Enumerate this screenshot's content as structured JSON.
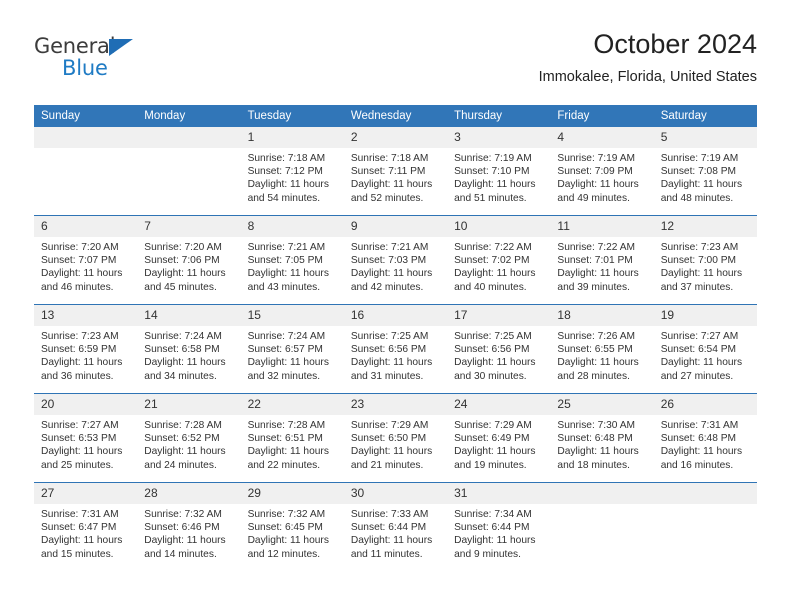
{
  "logo": {
    "word_one": "General",
    "word_two": "Blue",
    "triangle_icon": "triangle-icon",
    "brand_blue": "#1f7bc4",
    "brand_dark": "#3c3c3c"
  },
  "header": {
    "title": "October 2024",
    "subtitle": "Immokalee, Florida, United States"
  },
  "calendar": {
    "header_bg": "#3176b8",
    "daynum_bg": "#f0f0f0",
    "row_divider": "#2f74b5",
    "weekday_headers": [
      "Sunday",
      "Monday",
      "Tuesday",
      "Wednesday",
      "Thursday",
      "Friday",
      "Saturday"
    ],
    "weeks": [
      [
        {
          "day": "",
          "sunrise": "",
          "sunset": "",
          "daylight_line1": "",
          "daylight_line2": ""
        },
        {
          "day": "",
          "sunrise": "",
          "sunset": "",
          "daylight_line1": "",
          "daylight_line2": ""
        },
        {
          "day": "1",
          "sunrise": "Sunrise: 7:18 AM",
          "sunset": "Sunset: 7:12 PM",
          "daylight_line1": "Daylight: 11 hours",
          "daylight_line2": "and 54 minutes."
        },
        {
          "day": "2",
          "sunrise": "Sunrise: 7:18 AM",
          "sunset": "Sunset: 7:11 PM",
          "daylight_line1": "Daylight: 11 hours",
          "daylight_line2": "and 52 minutes."
        },
        {
          "day": "3",
          "sunrise": "Sunrise: 7:19 AM",
          "sunset": "Sunset: 7:10 PM",
          "daylight_line1": "Daylight: 11 hours",
          "daylight_line2": "and 51 minutes."
        },
        {
          "day": "4",
          "sunrise": "Sunrise: 7:19 AM",
          "sunset": "Sunset: 7:09 PM",
          "daylight_line1": "Daylight: 11 hours",
          "daylight_line2": "and 49 minutes."
        },
        {
          "day": "5",
          "sunrise": "Sunrise: 7:19 AM",
          "sunset": "Sunset: 7:08 PM",
          "daylight_line1": "Daylight: 11 hours",
          "daylight_line2": "and 48 minutes."
        }
      ],
      [
        {
          "day": "6",
          "sunrise": "Sunrise: 7:20 AM",
          "sunset": "Sunset: 7:07 PM",
          "daylight_line1": "Daylight: 11 hours",
          "daylight_line2": "and 46 minutes."
        },
        {
          "day": "7",
          "sunrise": "Sunrise: 7:20 AM",
          "sunset": "Sunset: 7:06 PM",
          "daylight_line1": "Daylight: 11 hours",
          "daylight_line2": "and 45 minutes."
        },
        {
          "day": "8",
          "sunrise": "Sunrise: 7:21 AM",
          "sunset": "Sunset: 7:05 PM",
          "daylight_line1": "Daylight: 11 hours",
          "daylight_line2": "and 43 minutes."
        },
        {
          "day": "9",
          "sunrise": "Sunrise: 7:21 AM",
          "sunset": "Sunset: 7:03 PM",
          "daylight_line1": "Daylight: 11 hours",
          "daylight_line2": "and 42 minutes."
        },
        {
          "day": "10",
          "sunrise": "Sunrise: 7:22 AM",
          "sunset": "Sunset: 7:02 PM",
          "daylight_line1": "Daylight: 11 hours",
          "daylight_line2": "and 40 minutes."
        },
        {
          "day": "11",
          "sunrise": "Sunrise: 7:22 AM",
          "sunset": "Sunset: 7:01 PM",
          "daylight_line1": "Daylight: 11 hours",
          "daylight_line2": "and 39 minutes."
        },
        {
          "day": "12",
          "sunrise": "Sunrise: 7:23 AM",
          "sunset": "Sunset: 7:00 PM",
          "daylight_line1": "Daylight: 11 hours",
          "daylight_line2": "and 37 minutes."
        }
      ],
      [
        {
          "day": "13",
          "sunrise": "Sunrise: 7:23 AM",
          "sunset": "Sunset: 6:59 PM",
          "daylight_line1": "Daylight: 11 hours",
          "daylight_line2": "and 36 minutes."
        },
        {
          "day": "14",
          "sunrise": "Sunrise: 7:24 AM",
          "sunset": "Sunset: 6:58 PM",
          "daylight_line1": "Daylight: 11 hours",
          "daylight_line2": "and 34 minutes."
        },
        {
          "day": "15",
          "sunrise": "Sunrise: 7:24 AM",
          "sunset": "Sunset: 6:57 PM",
          "daylight_line1": "Daylight: 11 hours",
          "daylight_line2": "and 32 minutes."
        },
        {
          "day": "16",
          "sunrise": "Sunrise: 7:25 AM",
          "sunset": "Sunset: 6:56 PM",
          "daylight_line1": "Daylight: 11 hours",
          "daylight_line2": "and 31 minutes."
        },
        {
          "day": "17",
          "sunrise": "Sunrise: 7:25 AM",
          "sunset": "Sunset: 6:56 PM",
          "daylight_line1": "Daylight: 11 hours",
          "daylight_line2": "and 30 minutes."
        },
        {
          "day": "18",
          "sunrise": "Sunrise: 7:26 AM",
          "sunset": "Sunset: 6:55 PM",
          "daylight_line1": "Daylight: 11 hours",
          "daylight_line2": "and 28 minutes."
        },
        {
          "day": "19",
          "sunrise": "Sunrise: 7:27 AM",
          "sunset": "Sunset: 6:54 PM",
          "daylight_line1": "Daylight: 11 hours",
          "daylight_line2": "and 27 minutes."
        }
      ],
      [
        {
          "day": "20",
          "sunrise": "Sunrise: 7:27 AM",
          "sunset": "Sunset: 6:53 PM",
          "daylight_line1": "Daylight: 11 hours",
          "daylight_line2": "and 25 minutes."
        },
        {
          "day": "21",
          "sunrise": "Sunrise: 7:28 AM",
          "sunset": "Sunset: 6:52 PM",
          "daylight_line1": "Daylight: 11 hours",
          "daylight_line2": "and 24 minutes."
        },
        {
          "day": "22",
          "sunrise": "Sunrise: 7:28 AM",
          "sunset": "Sunset: 6:51 PM",
          "daylight_line1": "Daylight: 11 hours",
          "daylight_line2": "and 22 minutes."
        },
        {
          "day": "23",
          "sunrise": "Sunrise: 7:29 AM",
          "sunset": "Sunset: 6:50 PM",
          "daylight_line1": "Daylight: 11 hours",
          "daylight_line2": "and 21 minutes."
        },
        {
          "day": "24",
          "sunrise": "Sunrise: 7:29 AM",
          "sunset": "Sunset: 6:49 PM",
          "daylight_line1": "Daylight: 11 hours",
          "daylight_line2": "and 19 minutes."
        },
        {
          "day": "25",
          "sunrise": "Sunrise: 7:30 AM",
          "sunset": "Sunset: 6:48 PM",
          "daylight_line1": "Daylight: 11 hours",
          "daylight_line2": "and 18 minutes."
        },
        {
          "day": "26",
          "sunrise": "Sunrise: 7:31 AM",
          "sunset": "Sunset: 6:48 PM",
          "daylight_line1": "Daylight: 11 hours",
          "daylight_line2": "and 16 minutes."
        }
      ],
      [
        {
          "day": "27",
          "sunrise": "Sunrise: 7:31 AM",
          "sunset": "Sunset: 6:47 PM",
          "daylight_line1": "Daylight: 11 hours",
          "daylight_line2": "and 15 minutes."
        },
        {
          "day": "28",
          "sunrise": "Sunrise: 7:32 AM",
          "sunset": "Sunset: 6:46 PM",
          "daylight_line1": "Daylight: 11 hours",
          "daylight_line2": "and 14 minutes."
        },
        {
          "day": "29",
          "sunrise": "Sunrise: 7:32 AM",
          "sunset": "Sunset: 6:45 PM",
          "daylight_line1": "Daylight: 11 hours",
          "daylight_line2": "and 12 minutes."
        },
        {
          "day": "30",
          "sunrise": "Sunrise: 7:33 AM",
          "sunset": "Sunset: 6:44 PM",
          "daylight_line1": "Daylight: 11 hours",
          "daylight_line2": "and 11 minutes."
        },
        {
          "day": "31",
          "sunrise": "Sunrise: 7:34 AM",
          "sunset": "Sunset: 6:44 PM",
          "daylight_line1": "Daylight: 11 hours",
          "daylight_line2": "and 9 minutes."
        },
        {
          "day": "",
          "sunrise": "",
          "sunset": "",
          "daylight_line1": "",
          "daylight_line2": ""
        },
        {
          "day": "",
          "sunrise": "",
          "sunset": "",
          "daylight_line1": "",
          "daylight_line2": ""
        }
      ]
    ]
  }
}
